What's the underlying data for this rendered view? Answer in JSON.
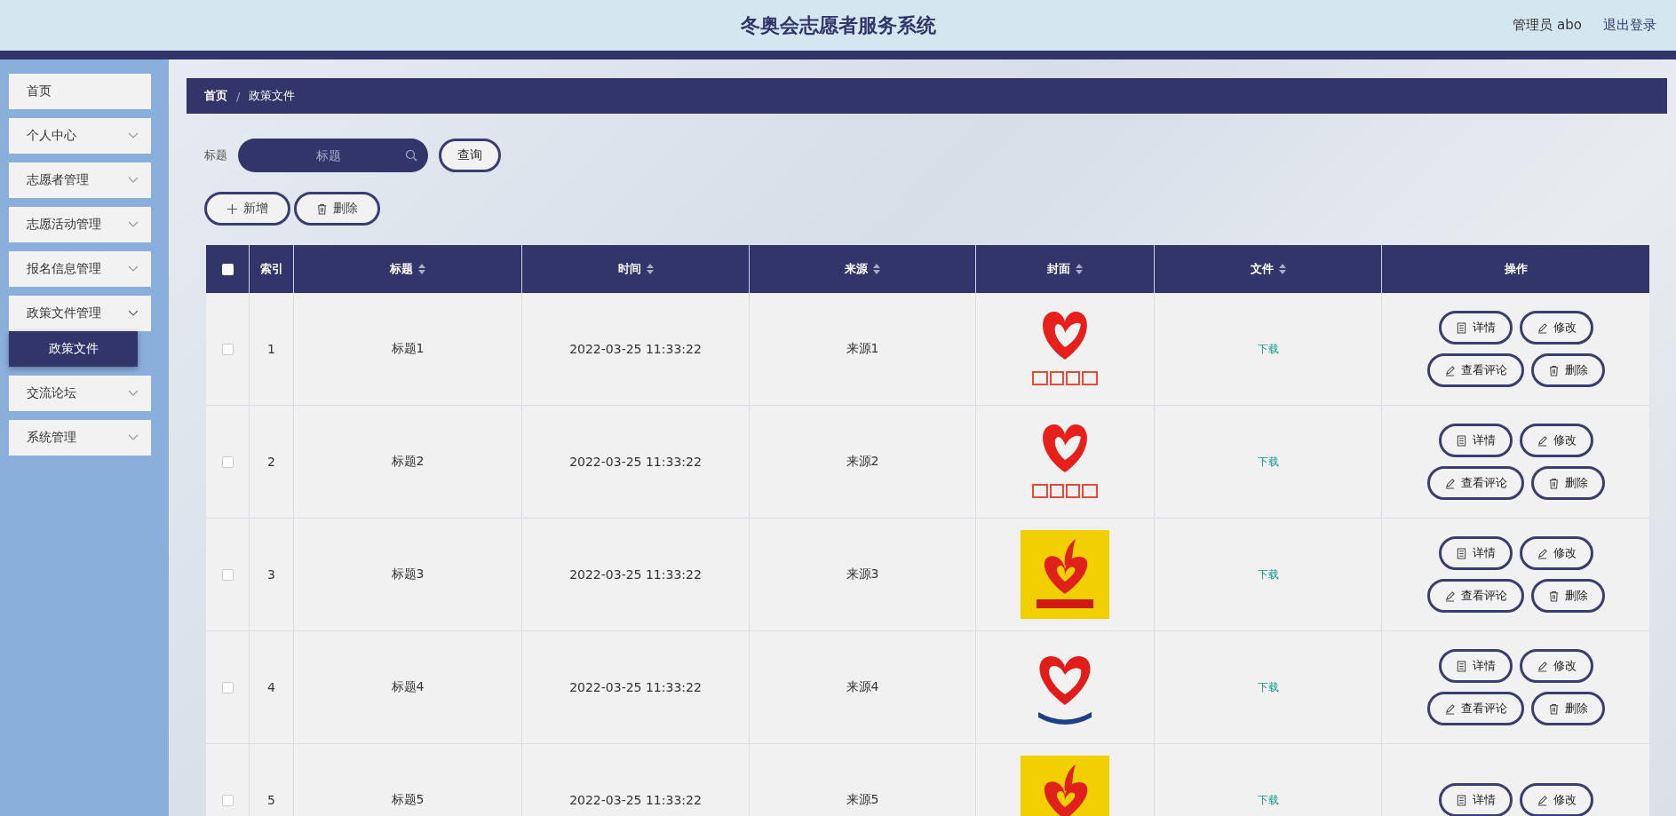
{
  "header": {
    "title": "冬奥会志愿者服务系统",
    "user": "管理员 abo",
    "logout": "退出登录"
  },
  "sidebar": {
    "items": [
      {
        "label": "首页",
        "kind": "link",
        "selected": false
      },
      {
        "label": "个人中心",
        "kind": "menu",
        "expanded": false,
        "selected": false
      },
      {
        "label": "志愿者管理",
        "kind": "menu",
        "expanded": false,
        "selected": false
      },
      {
        "label": "志愿活动管理",
        "kind": "menu",
        "expanded": false,
        "selected": false
      },
      {
        "label": "报名信息管理",
        "kind": "menu",
        "expanded": false,
        "selected": false
      },
      {
        "label": "政策文件管理",
        "kind": "menu",
        "expanded": true,
        "selected": false,
        "children": [
          {
            "label": "政策文件",
            "selected": true
          }
        ]
      },
      {
        "label": "交流论坛",
        "kind": "menu",
        "expanded": false,
        "selected": false
      },
      {
        "label": "系统管理",
        "kind": "menu",
        "expanded": false,
        "selected": false
      }
    ]
  },
  "breadcrumb": [
    "首页",
    "/",
    "政策文件"
  ],
  "search": {
    "label": "标题",
    "placeholder": "标题",
    "button": "查询"
  },
  "toolbar": [
    {
      "label": "新增",
      "kind": "add"
    },
    {
      "label": "删除",
      "kind": "delete"
    }
  ],
  "table": {
    "select_all": {
      "checked": false
    },
    "columns": [
      {
        "label": "索引",
        "sortable": false
      },
      {
        "label": "标题",
        "sortable": true
      },
      {
        "label": "时间",
        "sortable": true
      },
      {
        "label": "来源",
        "sortable": true
      },
      {
        "label": "封面",
        "sortable": true
      },
      {
        "label": "文件",
        "sortable": true
      },
      {
        "label": "操作",
        "sortable": false
      }
    ],
    "rows": [
      {
        "checked": false,
        "index": "1",
        "title": "标题1",
        "time": "2022-03-25 11:33:22",
        "source": "来源1",
        "cover": {
          "kind": "picture"
        },
        "file": "下载",
        "actions": [
          {
            "label": "详情",
            "kind": "detail"
          },
          {
            "label": "修改",
            "kind": "edit"
          },
          {
            "label": "查看评论",
            "kind": "edit"
          },
          {
            "label": "删除",
            "kind": "delete"
          }
        ]
      },
      {
        "checked": false,
        "index": "2",
        "title": "标题2",
        "time": "2022-03-25 11:33:22",
        "source": "来源2",
        "cover": {
          "kind": "picture"
        },
        "file": "下载",
        "actions": [
          {
            "label": "详情",
            "kind": "detail"
          },
          {
            "label": "修改",
            "kind": "edit"
          },
          {
            "label": "查看评论",
            "kind": "edit"
          },
          {
            "label": "删除",
            "kind": "delete"
          }
        ]
      },
      {
        "checked": false,
        "index": "3",
        "title": "标题3",
        "time": "2022-03-25 11:33:22",
        "source": "来源3",
        "cover": {
          "kind": "picture"
        },
        "file": "下载",
        "actions": [
          {
            "label": "详情",
            "kind": "detail"
          },
          {
            "label": "修改",
            "kind": "edit"
          },
          {
            "label": "查看评论",
            "kind": "edit"
          },
          {
            "label": "删除",
            "kind": "delete"
          }
        ]
      },
      {
        "checked": false,
        "index": "4",
        "title": "标题4",
        "time": "2022-03-25 11:33:22",
        "source": "来源4",
        "cover": {
          "kind": "picture"
        },
        "file": "下载",
        "actions": [
          {
            "label": "详情",
            "kind": "detail"
          },
          {
            "label": "修改",
            "kind": "edit"
          },
          {
            "label": "查看评论",
            "kind": "edit"
          },
          {
            "label": "删除",
            "kind": "delete"
          }
        ]
      },
      {
        "checked": false,
        "index": "5",
        "title": "标题5",
        "time": "2022-03-25 11:33:22",
        "source": "来源5",
        "cover": {
          "kind": "picture"
        },
        "file": "下载",
        "actions": [
          {
            "label": "详情",
            "kind": "detail"
          },
          {
            "label": "修改",
            "kind": "edit"
          }
        ]
      }
    ]
  }
}
